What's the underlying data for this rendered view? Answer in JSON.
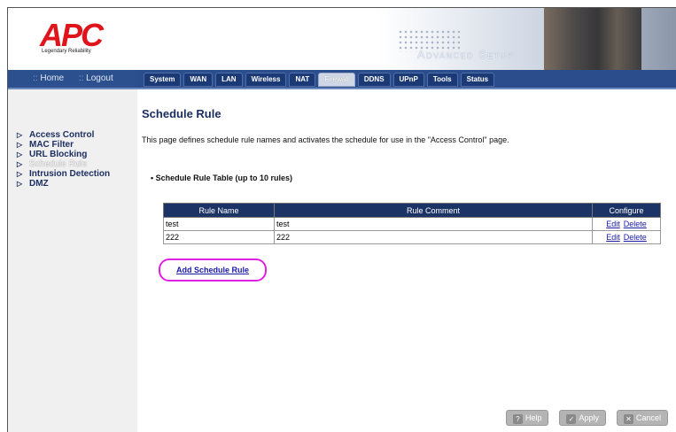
{
  "header": {
    "logo_text": "APC",
    "logo_tagline": "Legendary Reliability",
    "banner_title": "Advanced Setup"
  },
  "navbar": {
    "home": "Home",
    "logout": "Logout",
    "tabs": [
      "System",
      "WAN",
      "LAN",
      "Wireless",
      "NAT",
      "Firewall",
      "DDNS",
      "UPnP",
      "Tools",
      "Status"
    ],
    "active_tab": "Firewall"
  },
  "sidebar": {
    "items": [
      {
        "label": "Access Control"
      },
      {
        "label": "MAC Filter"
      },
      {
        "label": "URL Blocking"
      },
      {
        "label": "Schedule Rule"
      },
      {
        "label": "Intrusion Detection"
      },
      {
        "label": "DMZ"
      }
    ],
    "active_item": "Schedule Rule"
  },
  "main": {
    "title": "Schedule Rule",
    "description": "This page defines schedule rule names and activates the schedule for use in the \"Access Control\" page.",
    "section_title": "Schedule Rule Table (up to 10 rules)",
    "table": {
      "headers": [
        "Rule Name",
        "Rule Comment",
        "Configure"
      ],
      "rows": [
        {
          "name": "test",
          "comment": "test",
          "edit": "Edit",
          "delete": "Delete"
        },
        {
          "name": "222",
          "comment": "222",
          "edit": "Edit",
          "delete": "Delete"
        }
      ]
    },
    "add_button": "Add Schedule Rule"
  },
  "buttons": {
    "help": "Help",
    "apply": "Apply",
    "cancel": "Cancel"
  },
  "colors": {
    "navbar": "#2b4d8c",
    "table_header": "#1c3366",
    "highlight_circle": "#e020e0",
    "logo_red": "#e0151b"
  }
}
